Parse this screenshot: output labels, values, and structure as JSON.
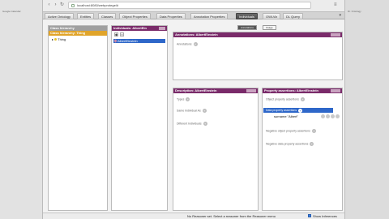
{
  "background_windows": {
    "left_title": "Google Calendar",
    "right_title": "Dr. Ontology"
  },
  "browser": {
    "url": "localhost:8080/webprotege/#",
    "menu_icon": "hamburger-icon"
  },
  "tabs": [
    {
      "label": "Active Ontology",
      "active": false
    },
    {
      "label": "Entities",
      "active": false
    },
    {
      "label": "Classes",
      "active": false
    },
    {
      "label": "Object Properties",
      "active": false
    },
    {
      "label": "Data Properties",
      "active": false
    },
    {
      "label": "Annotation Properties",
      "active": false
    },
    {
      "label": "Individuals",
      "active": true
    },
    {
      "label": "OWLViz",
      "active": false
    },
    {
      "label": "DL Query",
      "active": false
    }
  ],
  "class_hierarchy": {
    "header": "Class hierarchy",
    "subheader": "Class hierarchy: Thing",
    "root": "Thing"
  },
  "individuals": {
    "header": "Individuals: AlbertEin",
    "selected": "AlbertEinstein"
  },
  "view_toggle": {
    "left": "Annotations",
    "right": "Usage"
  },
  "annotations": {
    "header": "Annotations: AlbertEinstein",
    "label": "Annotations"
  },
  "description": {
    "header": "Description: AlbertEinstein",
    "rows": [
      "Types",
      "Same Individual As",
      "Different Individuals"
    ]
  },
  "property_assertions": {
    "header": "Property assertions: AlbertEinstein",
    "rows_before": [
      "Object property assertions"
    ],
    "highlighted": "Data property assertions",
    "assertion": "surname  \"Albert\"",
    "rows_after": [
      "Negative object property assertions",
      "Negative data property assertions"
    ]
  },
  "status_bar": {
    "message": "No Reasoner set. Select a reasoner from the Reasoner menu",
    "checkbox_label": "Show Inferences",
    "checkbox_checked": true
  },
  "colors": {
    "header_purple": "#7a2b6a",
    "selection_blue": "#2e67c9"
  }
}
